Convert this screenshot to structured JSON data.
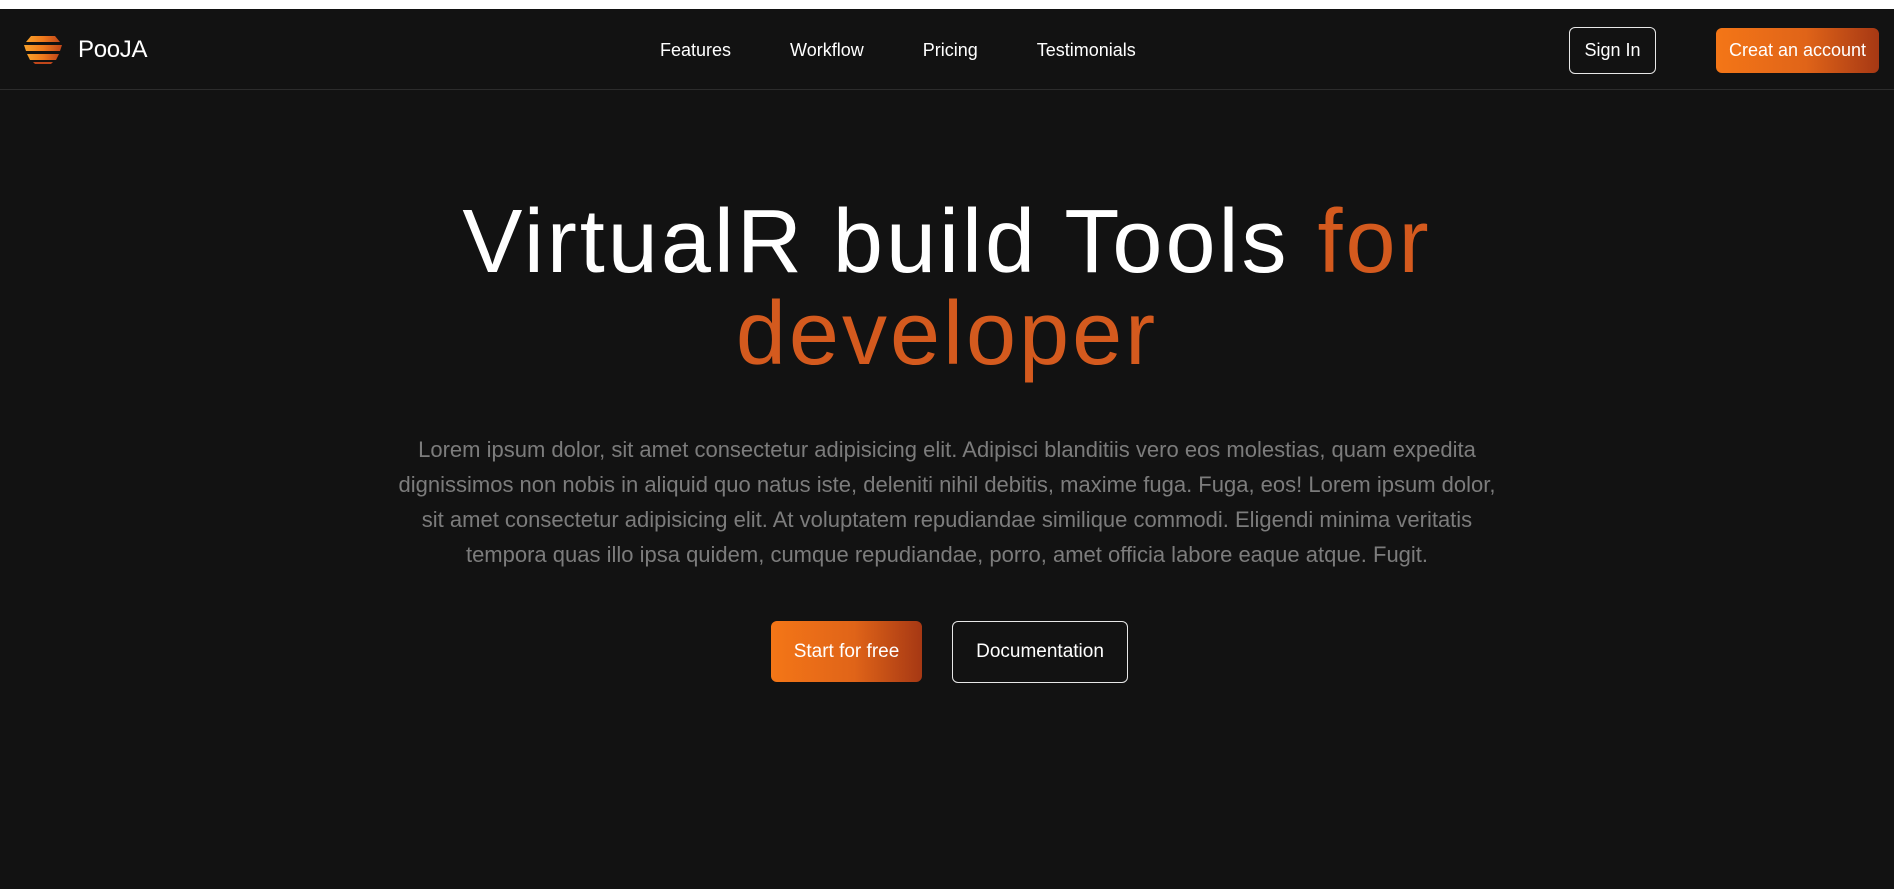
{
  "brand": {
    "name": "PooJA",
    "logo_icon": "stacked-layers-logo-icon"
  },
  "nav": {
    "links": [
      {
        "label": "Features"
      },
      {
        "label": "Workflow"
      },
      {
        "label": "Pricing"
      },
      {
        "label": "Testimonials"
      }
    ],
    "sign_in_label": "Sign In",
    "create_account_label": "Creat an account"
  },
  "hero": {
    "title_main": "VirtualR build Tools ",
    "title_accent_1": "for",
    "title_accent_2": "developer",
    "description": "Lorem ipsum dolor, sit amet consectetur adipisicing elit. Adipisci blanditiis vero eos molestias, quam expedita dignissimos non nobis in aliquid quo natus iste, deleniti nihil debitis, maxime fuga. Fuga, eos! Lorem ipsum dolor, sit amet consectetur adipisicing elit. At voluptatem repudiandae similique commodi. Eligendi minima veritatis tempora quas illo ipsa quidem, cumque repudiandae, porro, amet officia labore eaque atque. Fugit.",
    "primary_cta": "Start for free",
    "secondary_cta": "Documentation"
  },
  "colors": {
    "background": "#121212",
    "accent": "#d45a1e",
    "gradient_start": "#f47617",
    "gradient_end": "#a63814",
    "muted_text": "#7c7c7c"
  }
}
